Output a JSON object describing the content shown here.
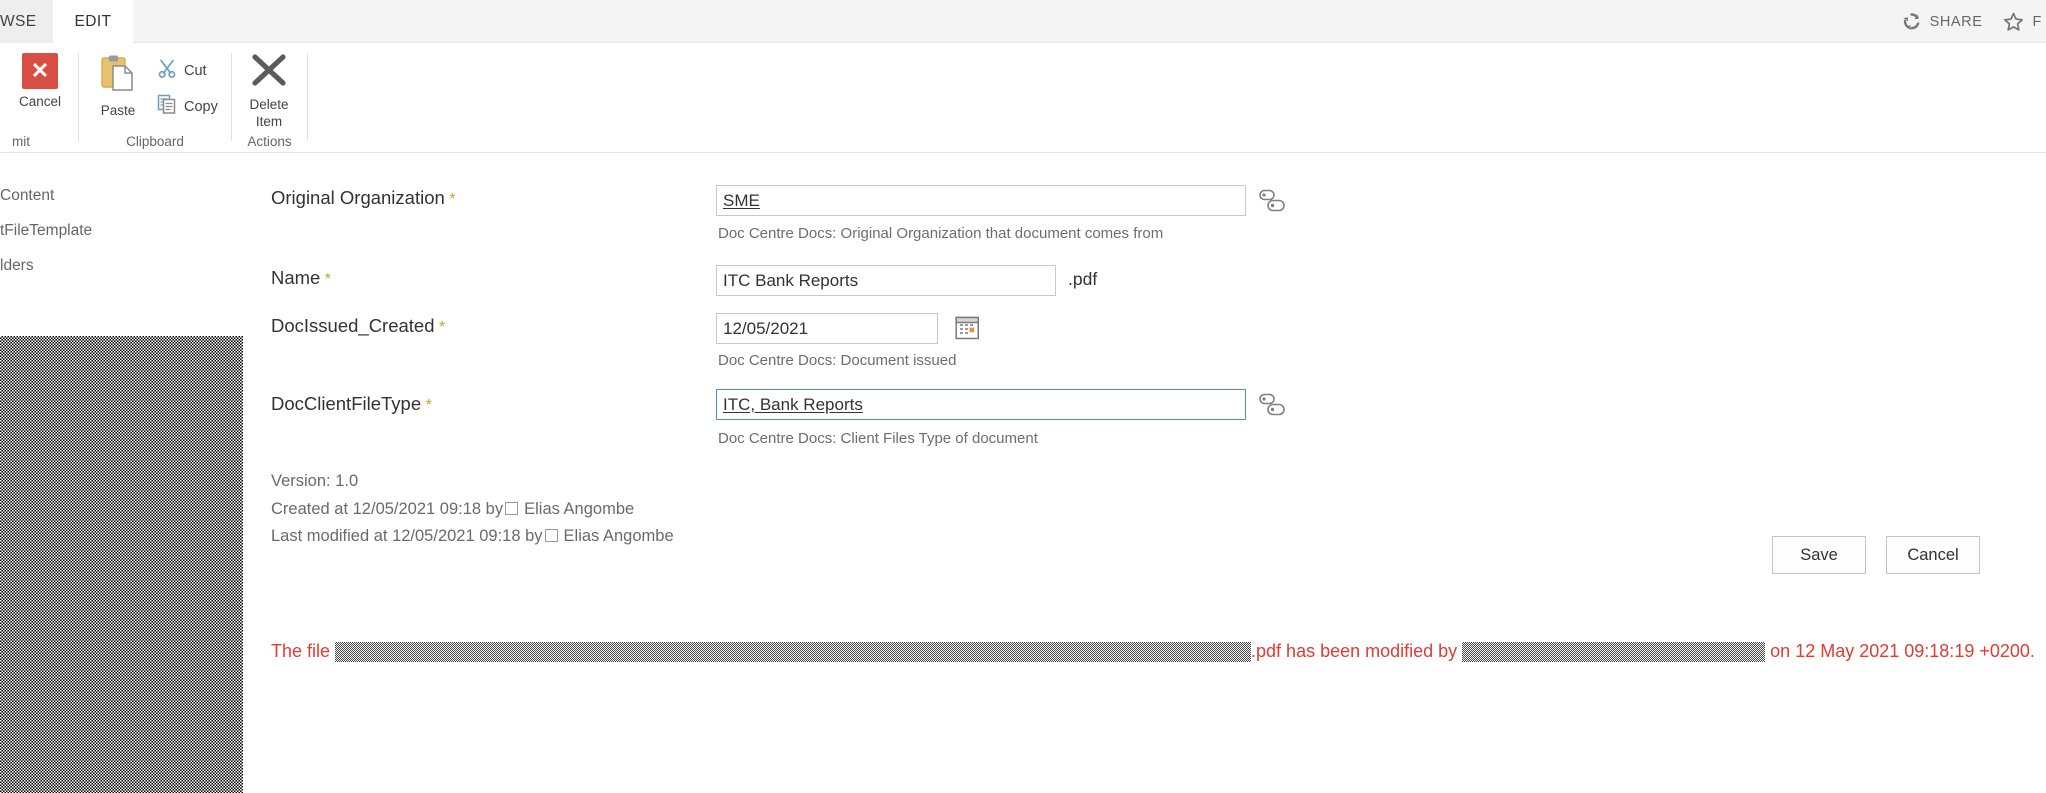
{
  "ribbon": {
    "tabs": [
      {
        "label": "WSE",
        "active": false
      },
      {
        "label": "EDIT",
        "active": true
      }
    ],
    "share_label": "SHARE",
    "follow_label": "F",
    "groups": [
      {
        "label": "mit"
      },
      {
        "label": "Clipboard"
      },
      {
        "label": "Actions"
      }
    ],
    "commands": {
      "cancel": "Cancel",
      "paste": "Paste",
      "cut": "Cut",
      "copy": "Copy",
      "delete_item_line1": "Delete",
      "delete_item_line2": "Item"
    }
  },
  "sidebar": {
    "items": [
      {
        "label": "Content"
      },
      {
        "label": "tFileTemplate"
      },
      {
        "label": "lders"
      }
    ]
  },
  "form": {
    "fields": [
      {
        "label": "Original Organization",
        "required": "*",
        "value": "SME",
        "description": "Doc Centre Docs: Original Organization that document comes from"
      },
      {
        "label": "Name",
        "required": "*",
        "value": "ITC Bank Reports",
        "suffix": ".pdf",
        "description": ""
      },
      {
        "label": "DocIssued_Created",
        "required": "*",
        "value": "12/05/2021",
        "description": "Doc Centre Docs: Document issued"
      },
      {
        "label": "DocClientFileType",
        "required": "*",
        "value": "ITC, Bank Reports",
        "description": "Doc Centre Docs: Client Files Type of document"
      }
    ],
    "meta": {
      "version": "Version: 1.0",
      "created_prefix": "Created at 12/05/2021 09:18  by",
      "created_user": "Elias Angombe",
      "modified_prefix": "Last modified at 12/05/2021 09:18  by",
      "modified_user": "Elias Angombe"
    },
    "buttons": {
      "save": "Save",
      "cancel": "Cancel"
    },
    "warning": {
      "prefix": "The file ",
      "middle": ".pdf has been modified by ",
      "suffix": " on 12 May 2021 09:18:19 +0200."
    }
  },
  "colors": {
    "cancel_red": "#d94f43",
    "warning_red": "#e03c31",
    "required_gold": "#c9a227",
    "focus_blue": "#4a93c9"
  }
}
